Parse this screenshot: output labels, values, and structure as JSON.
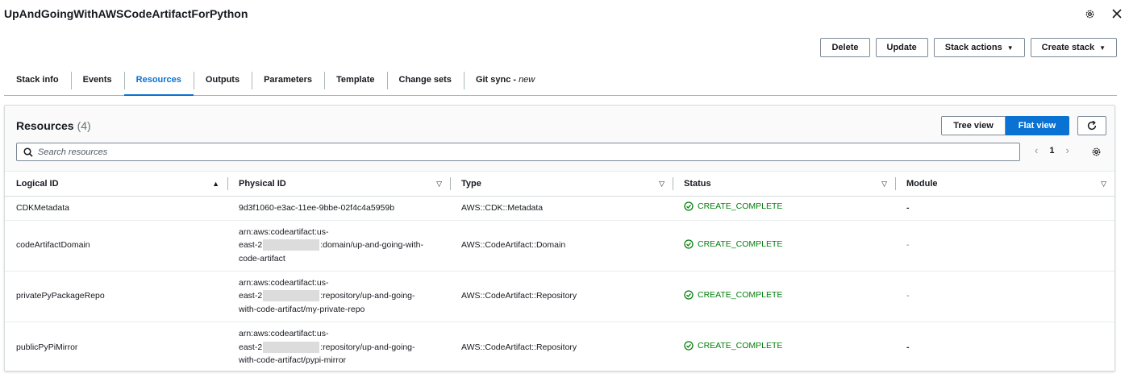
{
  "header": {
    "title": "UpAndGoingWithAWSCodeArtifactForPython"
  },
  "actions": {
    "delete": "Delete",
    "update": "Update",
    "stack_actions": "Stack actions",
    "create_stack": "Create stack"
  },
  "tabs": [
    {
      "label": "Stack info"
    },
    {
      "label": "Events"
    },
    {
      "label": "Resources"
    },
    {
      "label": "Outputs"
    },
    {
      "label": "Parameters"
    },
    {
      "label": "Template"
    },
    {
      "label": "Change sets"
    },
    {
      "label": "Git sync -",
      "badge": "new"
    }
  ],
  "active_tab": "Resources",
  "resources": {
    "title": "Resources",
    "count": "(4)",
    "view_tree": "Tree view",
    "view_flat": "Flat view",
    "selected_view": "Flat view",
    "search_placeholder": "Search resources",
    "page": "1",
    "columns": [
      "Logical ID",
      "Physical ID",
      "Type",
      "Status",
      "Module"
    ],
    "rows": [
      {
        "logical_id": "CDKMetadata",
        "physical_id": [
          "9d3f1060-e3ac-11ee-9bbe-02f4c4a5959b"
        ],
        "type": "AWS::CDK::Metadata",
        "status": "CREATE_COMPLETE",
        "module": "-"
      },
      {
        "logical_id": "codeArtifactDomain",
        "physical_id": [
          "arn:aws:codeartifact:us-",
          "east-2",
          ":domain/up-and-going-with-",
          "code-artifact"
        ],
        "type": "AWS::CodeArtifact::Domain",
        "status": "CREATE_COMPLETE",
        "module": "-"
      },
      {
        "logical_id": "privatePyPackageRepo",
        "physical_id": [
          "arn:aws:codeartifact:us-",
          "east-2",
          ":repository/up-and-going-",
          "with-code-artifact/my-private-repo"
        ],
        "type": "AWS::CodeArtifact::Repository",
        "status": "CREATE_COMPLETE",
        "module": "-"
      },
      {
        "logical_id": "publicPyPiMirror",
        "physical_id": [
          "arn:aws:codeartifact:us-",
          "east-2",
          ":repository/up-and-going-",
          "with-code-artifact/pypi-mirror"
        ],
        "type": "AWS::CodeArtifact::Repository",
        "status": "CREATE_COMPLETE",
        "module": "-"
      }
    ]
  },
  "colors": {
    "accent": "#0972d3",
    "success": "#037f0c",
    "border": "#7d8998"
  }
}
